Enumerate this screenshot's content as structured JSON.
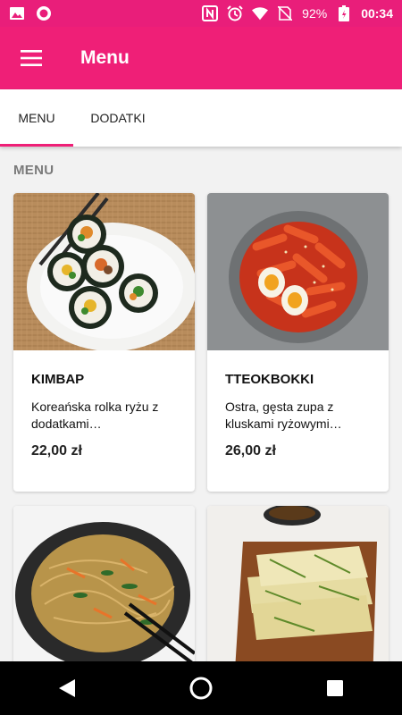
{
  "status_bar": {
    "battery": "92%",
    "time": "00:34",
    "icons": [
      "image-icon",
      "circle-icon",
      "nfc-icon",
      "alarm-icon",
      "wifi-icon",
      "no-sim-icon",
      "battery-icon"
    ]
  },
  "app_bar": {
    "title": "Menu",
    "menu_icon": "hamburger-icon"
  },
  "tabs": [
    {
      "label": "MENU",
      "active": true
    },
    {
      "label": "DODATKI",
      "active": false
    }
  ],
  "section": {
    "title": "MENU"
  },
  "items": [
    {
      "name": "KIMBAP",
      "description": "Koreańska rolka ryżu z dodatkami…",
      "price": "22,00 zł"
    },
    {
      "name": "TTEOKBOKKI",
      "description": "Ostra, gęsta zupa z kluskami ryżowymi…",
      "price": "26,00 zł"
    },
    {
      "name": "",
      "description": "",
      "price": ""
    },
    {
      "name": "",
      "description": "",
      "price": ""
    }
  ],
  "nav_bar": {
    "icons": [
      "back-icon",
      "home-icon",
      "recents-icon"
    ]
  },
  "colors": {
    "accent": "#ef1f77",
    "status_bar": "#e91e7a",
    "background": "#f2f2f2"
  }
}
